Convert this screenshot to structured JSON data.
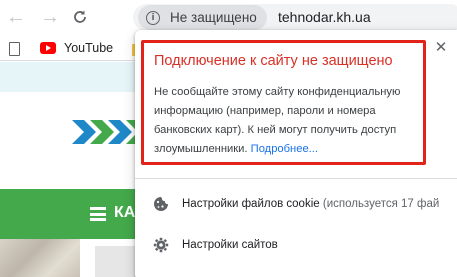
{
  "browser": {
    "security_chip_label": "Не защищено",
    "url": "tehnodar.kh.ua"
  },
  "bookmarks": {
    "items": [
      {
        "label": "YouTube",
        "icon": "youtube-icon"
      }
    ]
  },
  "page": {
    "menu_text": "КА"
  },
  "site_info_popup": {
    "title": "Подключение к сайту не защищено",
    "body": "Не сообщайте этому сайту конфиденциальную информацию (например, пароли и номера банковских карт). К ней могут получить доступ злоумышленники.",
    "learn_more": "Подробнее...",
    "cookies_label": "Настройки файлов cookie",
    "cookies_note": "(используется 17 фай",
    "site_settings_label": "Настройки сайтов"
  },
  "colors": {
    "warning_red": "#d93025",
    "highlight_border": "#e2231a",
    "link_blue": "#1a73e8",
    "site_green": "#43a94a"
  }
}
